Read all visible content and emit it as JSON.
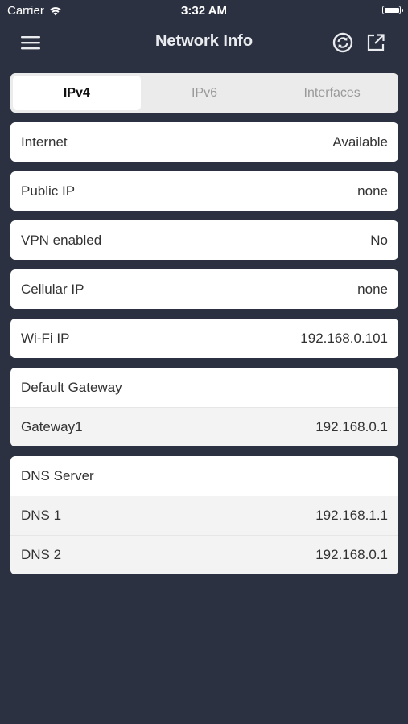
{
  "status_bar": {
    "carrier": "Carrier",
    "time": "3:32 AM"
  },
  "nav": {
    "title": "Network Info",
    "menu_icon": "hamburger-menu-icon",
    "refresh_icon": "refresh-icon",
    "share_icon": "share-icon"
  },
  "tabs": [
    {
      "label": "IPv4",
      "selected": true
    },
    {
      "label": "IPv6",
      "selected": false
    },
    {
      "label": "Interfaces",
      "selected": false
    }
  ],
  "rows": {
    "internet": {
      "label": "Internet",
      "value": "Available"
    },
    "public_ip": {
      "label": "Public IP",
      "value": "none"
    },
    "vpn": {
      "label": "VPN enabled",
      "value": "No"
    },
    "cellular_ip": {
      "label": "Cellular IP",
      "value": "none"
    },
    "wifi_ip": {
      "label": "Wi-Fi IP",
      "value": "192.168.0.101"
    }
  },
  "gateway": {
    "header": "Default Gateway",
    "items": [
      {
        "label": "Gateway1",
        "value": "192.168.0.1"
      }
    ]
  },
  "dns": {
    "header": "DNS Server",
    "items": [
      {
        "label": "DNS 1",
        "value": "192.168.1.1"
      },
      {
        "label": "DNS 2",
        "value": "192.168.0.1"
      }
    ]
  },
  "colors": {
    "background": "#2b3140",
    "card": "#ffffff",
    "segment_bg": "#ebebeb"
  }
}
